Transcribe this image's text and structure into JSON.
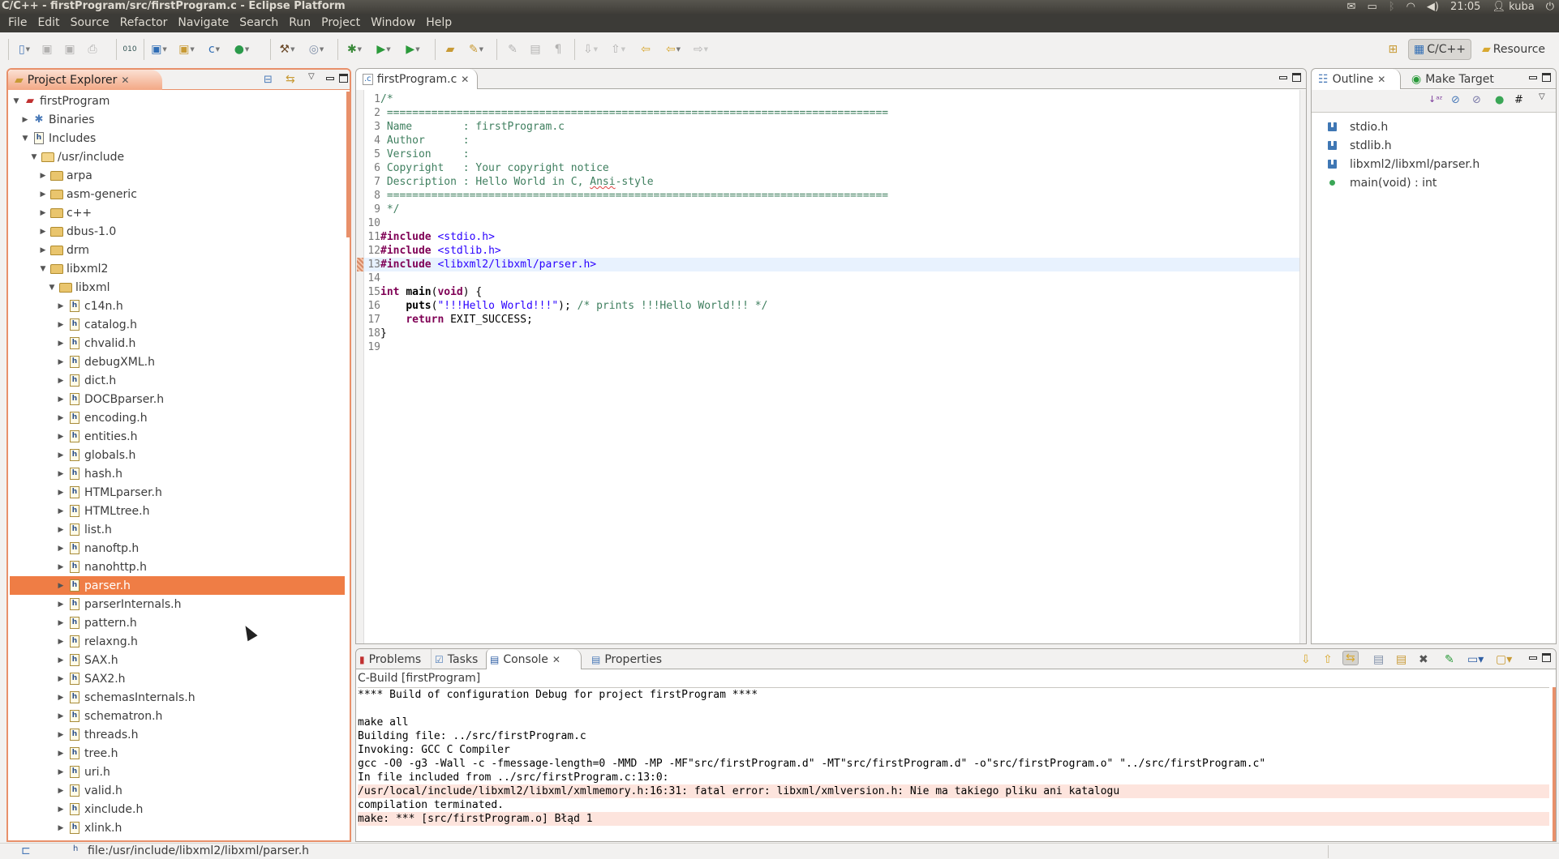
{
  "titlebar": {
    "title": "C/C++ - firstProgram/src/firstProgram.c - Eclipse Platform",
    "clock": "21:05",
    "user": "kuba",
    "tray_icons": [
      "mail-icon",
      "battery-icon",
      "bluetooth-icon",
      "wifi-icon",
      "volume-icon",
      "user-icon",
      "power-icon"
    ]
  },
  "menu": [
    "File",
    "Edit",
    "Source",
    "Refactor",
    "Navigate",
    "Search",
    "Run",
    "Project",
    "Window",
    "Help"
  ],
  "toolbar": {
    "perspectives": [
      {
        "label": "C/C++",
        "active": true
      },
      {
        "label": "Resource",
        "active": false
      }
    ]
  },
  "project_explorer": {
    "title": "Project Explorer",
    "tree": [
      {
        "label": "firstProgram",
        "depth": 0,
        "expanded": true,
        "icon": "project"
      },
      {
        "label": "Binaries",
        "depth": 1,
        "expanded": false,
        "icon": "binaries"
      },
      {
        "label": "Includes",
        "depth": 1,
        "expanded": true,
        "icon": "includes"
      },
      {
        "label": "/usr/include",
        "depth": 2,
        "expanded": true,
        "icon": "include-folder"
      },
      {
        "label": "arpa",
        "depth": 3,
        "expanded": false,
        "icon": "folder"
      },
      {
        "label": "asm-generic",
        "depth": 3,
        "expanded": false,
        "icon": "folder"
      },
      {
        "label": "c++",
        "depth": 3,
        "expanded": false,
        "icon": "folder"
      },
      {
        "label": "dbus-1.0",
        "depth": 3,
        "expanded": false,
        "icon": "folder"
      },
      {
        "label": "drm",
        "depth": 3,
        "expanded": false,
        "icon": "folder"
      },
      {
        "label": "libxml2",
        "depth": 3,
        "expanded": true,
        "icon": "folder"
      },
      {
        "label": "libxml",
        "depth": 4,
        "expanded": true,
        "icon": "folder"
      },
      {
        "label": "c14n.h",
        "depth": 5,
        "expanded": false,
        "icon": "header"
      },
      {
        "label": "catalog.h",
        "depth": 5,
        "expanded": false,
        "icon": "header"
      },
      {
        "label": "chvalid.h",
        "depth": 5,
        "expanded": false,
        "icon": "header"
      },
      {
        "label": "debugXML.h",
        "depth": 5,
        "expanded": false,
        "icon": "header"
      },
      {
        "label": "dict.h",
        "depth": 5,
        "expanded": false,
        "icon": "header"
      },
      {
        "label": "DOCBparser.h",
        "depth": 5,
        "expanded": false,
        "icon": "header"
      },
      {
        "label": "encoding.h",
        "depth": 5,
        "expanded": false,
        "icon": "header"
      },
      {
        "label": "entities.h",
        "depth": 5,
        "expanded": false,
        "icon": "header"
      },
      {
        "label": "globals.h",
        "depth": 5,
        "expanded": false,
        "icon": "header"
      },
      {
        "label": "hash.h",
        "depth": 5,
        "expanded": false,
        "icon": "header"
      },
      {
        "label": "HTMLparser.h",
        "depth": 5,
        "expanded": false,
        "icon": "header"
      },
      {
        "label": "HTMLtree.h",
        "depth": 5,
        "expanded": false,
        "icon": "header"
      },
      {
        "label": "list.h",
        "depth": 5,
        "expanded": false,
        "icon": "header"
      },
      {
        "label": "nanoftp.h",
        "depth": 5,
        "expanded": false,
        "icon": "header"
      },
      {
        "label": "nanohttp.h",
        "depth": 5,
        "expanded": false,
        "icon": "header"
      },
      {
        "label": "parser.h",
        "depth": 5,
        "expanded": false,
        "icon": "header",
        "selected": true
      },
      {
        "label": "parserInternals.h",
        "depth": 5,
        "expanded": false,
        "icon": "header"
      },
      {
        "label": "pattern.h",
        "depth": 5,
        "expanded": false,
        "icon": "header"
      },
      {
        "label": "relaxng.h",
        "depth": 5,
        "expanded": false,
        "icon": "header"
      },
      {
        "label": "SAX.h",
        "depth": 5,
        "expanded": false,
        "icon": "header"
      },
      {
        "label": "SAX2.h",
        "depth": 5,
        "expanded": false,
        "icon": "header"
      },
      {
        "label": "schemasInternals.h",
        "depth": 5,
        "expanded": false,
        "icon": "header"
      },
      {
        "label": "schematron.h",
        "depth": 5,
        "expanded": false,
        "icon": "header"
      },
      {
        "label": "threads.h",
        "depth": 5,
        "expanded": false,
        "icon": "header"
      },
      {
        "label": "tree.h",
        "depth": 5,
        "expanded": false,
        "icon": "header"
      },
      {
        "label": "uri.h",
        "depth": 5,
        "expanded": false,
        "icon": "header"
      },
      {
        "label": "valid.h",
        "depth": 5,
        "expanded": false,
        "icon": "header"
      },
      {
        "label": "xinclude.h",
        "depth": 5,
        "expanded": false,
        "icon": "header"
      },
      {
        "label": "xlink.h",
        "depth": 5,
        "expanded": false,
        "icon": "header"
      }
    ]
  },
  "editor": {
    "tab_label": "firstProgram.c",
    "current_line": 13,
    "error_line": 13,
    "lines": [
      [
        {
          "t": "/*",
          "c": "cmt"
        }
      ],
      [
        {
          "t": " ===============================================================================",
          "c": "cmt"
        }
      ],
      [
        {
          "t": " Name        : firstProgram.c",
          "c": "cmt"
        }
      ],
      [
        {
          "t": " Author      :",
          "c": "cmt"
        }
      ],
      [
        {
          "t": " Version     :",
          "c": "cmt"
        }
      ],
      [
        {
          "t": " Copyright   : Your copyright notice",
          "c": "cmt"
        }
      ],
      [
        {
          "t": " Description : Hello World in C, ",
          "c": "cmt"
        },
        {
          "t": "Ansi",
          "c": "cmt squiggle"
        },
        {
          "t": "-style",
          "c": "cmt"
        }
      ],
      [
        {
          "t": " ===============================================================================",
          "c": "cmt"
        }
      ],
      [
        {
          "t": " */",
          "c": "cmt"
        }
      ],
      [],
      [
        {
          "t": "#include",
          "c": "kw"
        },
        {
          "t": " ",
          "c": "plain"
        },
        {
          "t": "<stdio.h>",
          "c": "inc"
        }
      ],
      [
        {
          "t": "#include",
          "c": "kw"
        },
        {
          "t": " ",
          "c": "plain"
        },
        {
          "t": "<stdlib.h>",
          "c": "inc"
        }
      ],
      [
        {
          "t": "#include",
          "c": "kw"
        },
        {
          "t": " ",
          "c": "plain"
        },
        {
          "t": "<libxml2/libxml/parser.h>",
          "c": "inc"
        }
      ],
      [],
      [
        {
          "t": "int",
          "c": "kw"
        },
        {
          "t": " ",
          "c": "plain"
        },
        {
          "t": "main",
          "c": "fn"
        },
        {
          "t": "(",
          "c": "plain"
        },
        {
          "t": "void",
          "c": "kw"
        },
        {
          "t": ") {",
          "c": "plain"
        }
      ],
      [
        {
          "t": "    ",
          "c": "plain"
        },
        {
          "t": "puts",
          "c": "fn"
        },
        {
          "t": "(",
          "c": "plain"
        },
        {
          "t": "\"!!!Hello World!!!\"",
          "c": "str"
        },
        {
          "t": "); ",
          "c": "plain"
        },
        {
          "t": "/* prints !!!Hello World!!! */",
          "c": "cmt"
        }
      ],
      [
        {
          "t": "    ",
          "c": "plain"
        },
        {
          "t": "return",
          "c": "kw"
        },
        {
          "t": " EXIT_SUCCESS;",
          "c": "plain"
        }
      ],
      [
        {
          "t": "}",
          "c": "plain"
        }
      ],
      []
    ]
  },
  "outline": {
    "tabs": [
      {
        "label": "Outline",
        "active": true
      },
      {
        "label": "Make Target",
        "active": false
      }
    ],
    "items": [
      {
        "label": "stdio.h",
        "icon": "include"
      },
      {
        "label": "stdlib.h",
        "icon": "include"
      },
      {
        "label": "libxml2/libxml/parser.h",
        "icon": "include"
      },
      {
        "label": "main(void) : int",
        "icon": "function"
      }
    ]
  },
  "bottom": {
    "tabs": [
      {
        "label": "Problems",
        "active": false
      },
      {
        "label": "Tasks",
        "active": false
      },
      {
        "label": "Console",
        "active": true
      },
      {
        "label": "Properties",
        "active": false
      }
    ],
    "console_label": "C-Build [firstProgram]",
    "console_lines": [
      {
        "t": "**** Build of configuration Debug for project firstProgram ****",
        "err": false
      },
      {
        "t": "",
        "err": false
      },
      {
        "t": "make all",
        "err": false
      },
      {
        "t": "Building file: ../src/firstProgram.c",
        "err": false
      },
      {
        "t": "Invoking: GCC C Compiler",
        "err": false
      },
      {
        "t": "gcc -O0 -g3 -Wall -c -fmessage-length=0 -MMD -MP -MF\"src/firstProgram.d\" -MT\"src/firstProgram.d\" -o\"src/firstProgram.o\" \"../src/firstProgram.c\"",
        "err": false
      },
      {
        "t": "In file included from ../src/firstProgram.c:13:0:",
        "err": false
      },
      {
        "t": "/usr/local/include/libxml2/libxml/xmlmemory.h:16:31: fatal error: libxml/xmlversion.h: Nie ma takiego pliku ani katalogu",
        "err": true
      },
      {
        "t": "compilation terminated.",
        "err": false
      },
      {
        "t": "make: *** [src/firstProgram.o] Błąd 1",
        "err": true
      }
    ]
  },
  "statusbar": {
    "path": "file:/usr/include/libxml2/libxml/parser.h"
  }
}
